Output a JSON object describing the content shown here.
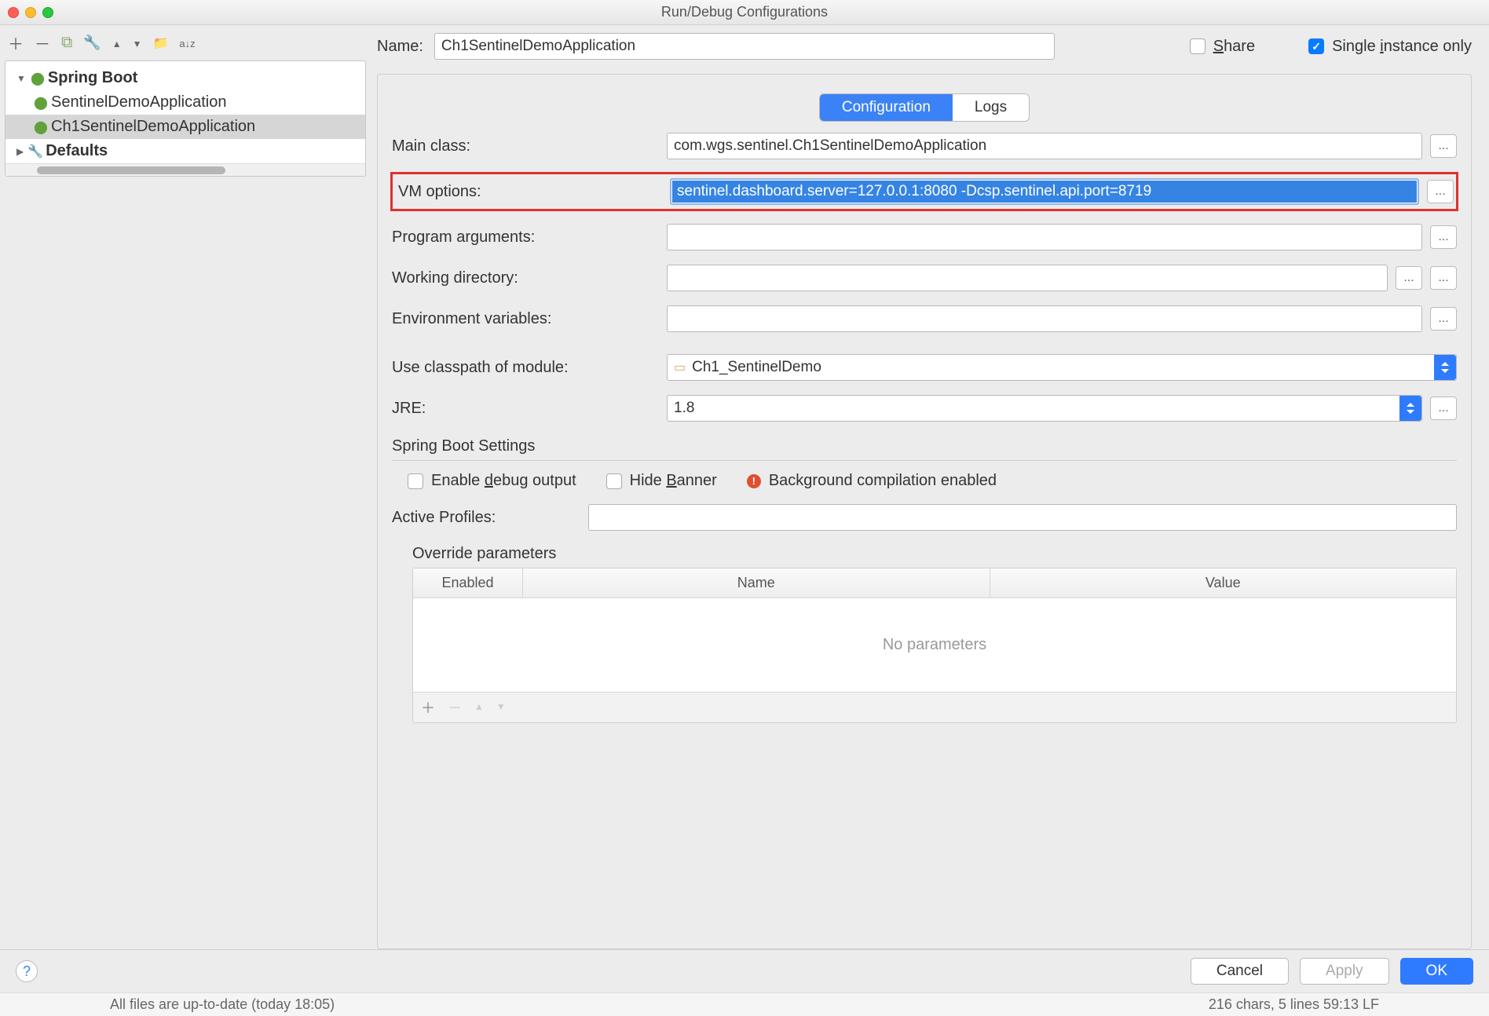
{
  "window": {
    "title": "Run/Debug Configurations"
  },
  "tree": {
    "groups": [
      {
        "label": "Spring Boot",
        "items": [
          "SentinelDemoApplication",
          "Ch1SentinelDemoApplication"
        ],
        "selectedIndex": 1
      },
      {
        "label": "Defaults"
      }
    ]
  },
  "header": {
    "name_label": "Name:",
    "name_value": "Ch1SentinelDemoApplication",
    "share_label": "Share",
    "single_instance_label": "Single instance only"
  },
  "tabs": {
    "configuration": "Configuration",
    "logs": "Logs"
  },
  "form": {
    "main_class_label": "Main class:",
    "main_class_value": "com.wgs.sentinel.Ch1SentinelDemoApplication",
    "vm_options_label": "VM options:",
    "vm_options_value": "sentinel.dashboard.server=127.0.0.1:8080 -Dcsp.sentinel.api.port=8719",
    "program_args_label": "Program arguments:",
    "program_args_value": "",
    "working_dir_label": "Working directory:",
    "working_dir_value": "",
    "env_vars_label": "Environment variables:",
    "env_vars_value": "",
    "classpath_label": "Use classpath of module:",
    "classpath_value": "Ch1_SentinelDemo",
    "jre_label": "JRE:",
    "jre_value": "1.8"
  },
  "spring": {
    "section": "Spring Boot Settings",
    "enable_debug": "Enable debug output",
    "hide_banner": "Hide Banner",
    "bg_compile": "Background compilation enabled",
    "active_profiles_label": "Active Profiles:",
    "active_profiles_value": "",
    "override_title": "Override parameters",
    "col_enabled": "Enabled",
    "col_name": "Name",
    "col_value": "Value",
    "no_params": "No parameters"
  },
  "footer": {
    "cancel": "Cancel",
    "apply": "Apply",
    "ok": "OK"
  },
  "status": {
    "left": "All files are up-to-date (today 18:05)",
    "right": "216 chars, 5 lines    59:13   LF"
  }
}
